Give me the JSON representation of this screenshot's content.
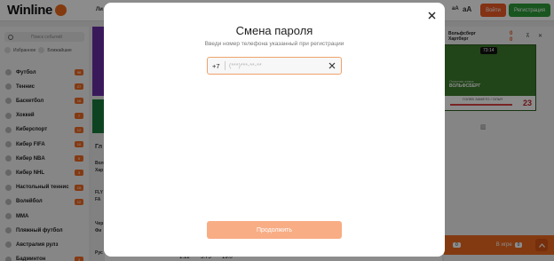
{
  "header": {
    "logo": "Winline",
    "tab_partial": "Ли",
    "font_small": "aA",
    "font_large": "aA",
    "login_label": "Войти",
    "register_label": "Регистрация"
  },
  "sidebar": {
    "search_placeholder": "Поиск событий",
    "filters": [
      {
        "label": "Избранное",
        "icon": "star-icon"
      },
      {
        "label": "Ближайшие",
        "icon": "clock-icon"
      }
    ],
    "sports": [
      {
        "label": "Футбол",
        "count": "98"
      },
      {
        "label": "Теннис",
        "count": "27"
      },
      {
        "label": "Баскетбол",
        "count": "16"
      },
      {
        "label": "Хоккей",
        "count": "7"
      },
      {
        "label": "Киберспорт",
        "count": "12"
      },
      {
        "label": "Кибер FIFA",
        "count": "10"
      },
      {
        "label": "Кибер NBA",
        "count": "5"
      },
      {
        "label": "Кибер NHL",
        "count": "3"
      },
      {
        "label": "Настольный теннис",
        "count": "15"
      },
      {
        "label": "Волейбол",
        "count": "12"
      },
      {
        "label": "MMA",
        "count": ""
      },
      {
        "label": "Пляжный футбол",
        "count": ""
      },
      {
        "label": "Австралия рулз",
        "count": ""
      },
      {
        "label": "Бадминтон",
        "count": "3"
      }
    ]
  },
  "center": {
    "edge_texts": [
      "Гл",
      "Вол",
      "Хар",
      "FLY",
      "FA",
      "Чер",
      "Фи",
      "Рус"
    ],
    "bottom_odds": [
      "1.12",
      "5.75",
      "19.0"
    ]
  },
  "live_match": {
    "team1": "Вольфсберг",
    "team2": "Хартберг",
    "score1": "0",
    "score2": "0",
    "timer": "73:14",
    "field_team": "ВОЛЬФСБЕРГ",
    "field_event": "Опасная атака",
    "stat_label": "ГОЛЕВ ЗАМЕТО / ОЛЬЯ",
    "stat_value": "23"
  },
  "bottom_bar": {
    "tab1_count": "0",
    "tab2_label": "В игре",
    "tab2_count": "0"
  },
  "modal": {
    "title": "Смена пароля",
    "subtitle": "Введи номер телефона указанный при регистрации",
    "phone_prefix": "+7",
    "phone_placeholder": "(***)***-**-**",
    "phone_value": "",
    "continue_label": "Продолжить",
    "accent_color": "#f0a26b",
    "button_color": "#f8ad85"
  }
}
